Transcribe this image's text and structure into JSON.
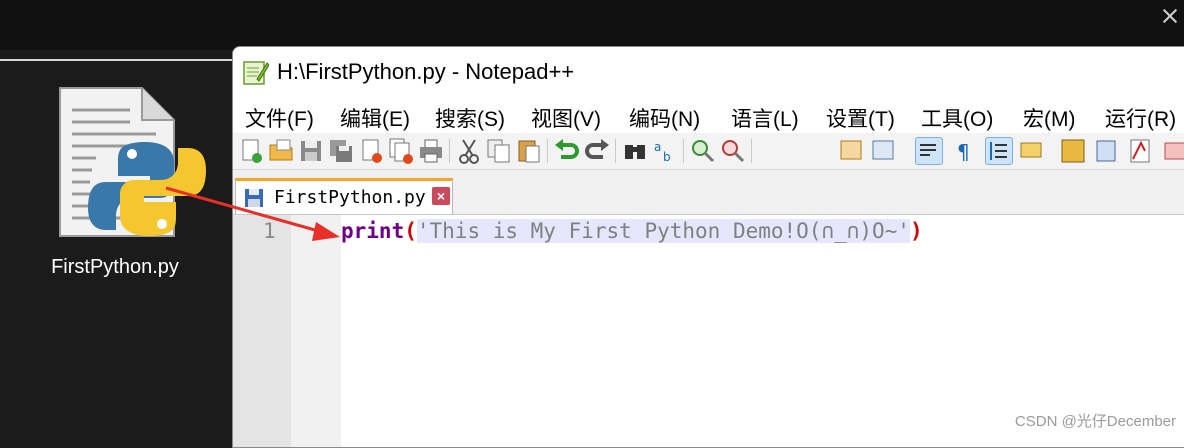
{
  "desktop": {
    "file_label": "FirstPython.py"
  },
  "window": {
    "title": "H:\\FirstPython.py - Notepad++"
  },
  "menu": [
    "文件(F)",
    "编辑(E)",
    "搜索(S)",
    "视图(V)",
    "编码(N)",
    "语言(L)",
    "设置(T)",
    "工具(O)",
    "宏(M)",
    "运行(R)"
  ],
  "toolbar": {
    "buttons": [
      "new-file-icon",
      "open-file-icon",
      "save-icon",
      "save-all-icon",
      "close-icon",
      "close-all-icon",
      "print-icon",
      "cut-icon",
      "copy-icon",
      "paste-icon",
      "undo-icon",
      "redo-icon",
      "find-icon",
      "replace-icon",
      "zoom-in-icon",
      "zoom-out-icon",
      "sync-vertical-icon",
      "sync-horizontal-icon",
      "word-wrap-icon",
      "show-all-chars-icon",
      "indent-guide-icon",
      "doc-map-icon",
      "function-list-icon",
      "folder-workspace-icon",
      "monitoring-icon",
      "record-macro-icon",
      "stop-record-icon"
    ]
  },
  "tab": {
    "label": "FirstPython.py",
    "close_glyph": "×"
  },
  "editor": {
    "line_number": "1",
    "keyword": "print",
    "open_paren": "(",
    "string": "'This is My First Python Demo!O(∩_∩)O~'",
    "close_paren": ")"
  },
  "watermark": "CSDN @光仔December",
  "colors": {
    "keyword": "#6b0084",
    "paren": "#d00000",
    "string": "#808080",
    "arrow": "#e8302a"
  }
}
